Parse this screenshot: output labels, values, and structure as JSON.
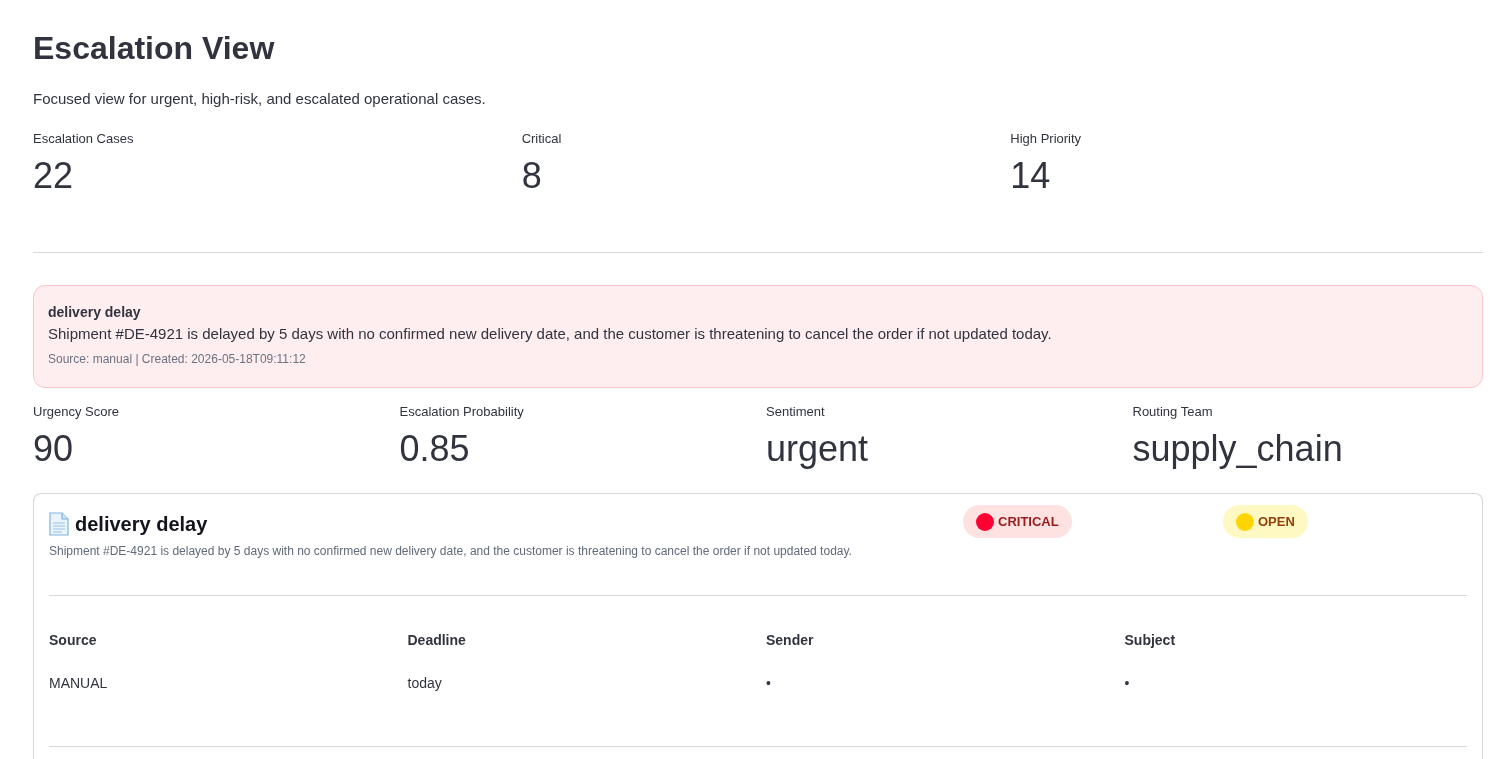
{
  "page": {
    "title": "Escalation View",
    "subtitle": "Focused view for urgent, high-risk, and escalated operational cases."
  },
  "summary_metrics": [
    {
      "label": "Escalation Cases",
      "value": "22"
    },
    {
      "label": "Critical",
      "value": "8"
    },
    {
      "label": "High Priority",
      "value": "14"
    }
  ],
  "alert": {
    "title": "delivery delay",
    "message": "Shipment #DE-4921 is delayed by 5 days with no confirmed new delivery date, and the customer is threatening to cancel the order if not updated today.",
    "meta": "Source: manual | Created: 2026-05-18T09:11:12"
  },
  "case_metrics": [
    {
      "label": "Urgency Score",
      "value": "90"
    },
    {
      "label": "Escalation Probability",
      "value": "0.85"
    },
    {
      "label": "Sentiment",
      "value": "urgent"
    },
    {
      "label": "Routing Team",
      "value": "supply_chain"
    }
  ],
  "case_card": {
    "title": "delivery delay",
    "description": "Shipment #DE-4921 is delayed by 5 days with no confirmed new delivery date, and the customer is threatening to cancel the order if not updated today.",
    "badges": [
      {
        "kind": "severity",
        "label": "CRITICAL",
        "color": "#ff0033"
      },
      {
        "kind": "status",
        "label": "OPEN",
        "color": "#ffd500"
      }
    ],
    "fields": [
      {
        "label": "Source",
        "value": "MANUAL"
      },
      {
        "label": "Deadline",
        "value": "today"
      },
      {
        "label": "Sender",
        "value": "•"
      },
      {
        "label": "Subject",
        "value": "•"
      }
    ]
  }
}
